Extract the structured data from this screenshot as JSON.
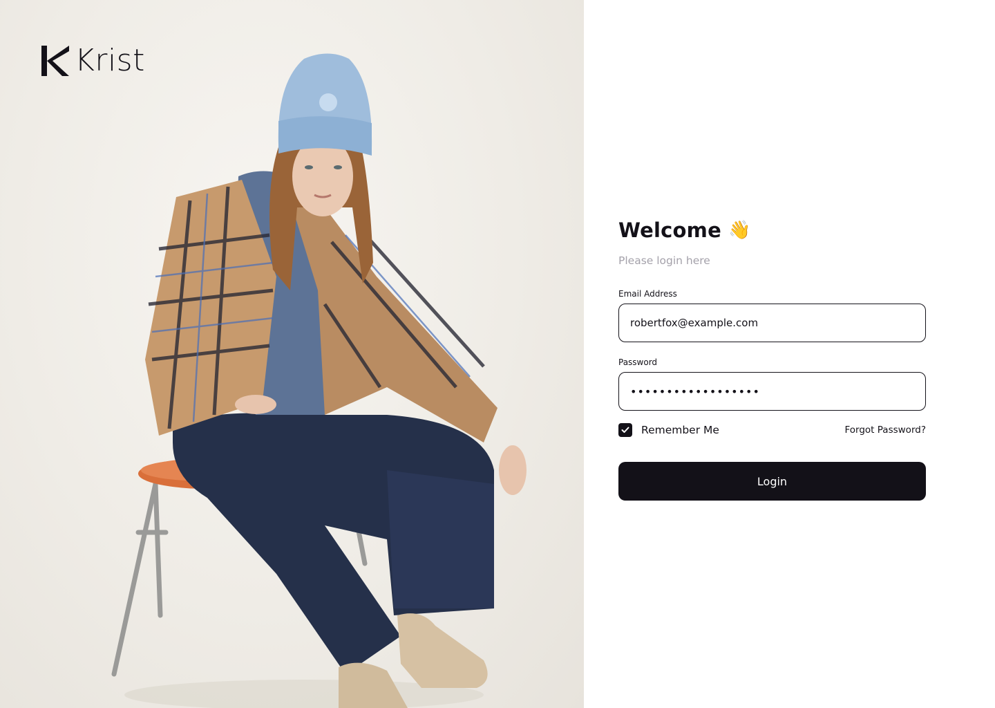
{
  "brand": {
    "name": "Krist",
    "logo_icon": "krist-k-logo-icon"
  },
  "login": {
    "title": "Welcome",
    "title_emoji": "👋",
    "subtitle": "Please login here",
    "email": {
      "label": "Email Address",
      "value": "robertfox@example.com"
    },
    "password": {
      "label": "Password",
      "value": "••••••••••••••••••"
    },
    "remember": {
      "label": "Remember Me",
      "checked": true,
      "icon": "check-icon"
    },
    "forgot_label": "Forgot Password?",
    "submit_label": "Login"
  },
  "colors": {
    "primary": "#131118",
    "muted_text": "#A4A1AA",
    "background": "#FFFFFF"
  }
}
